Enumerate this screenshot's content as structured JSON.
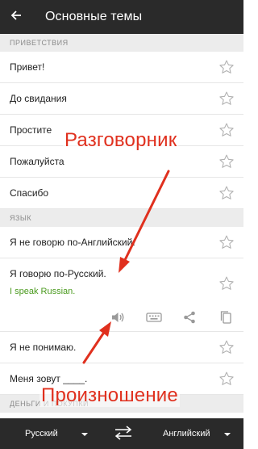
{
  "appbar": {
    "title": "Основные темы"
  },
  "sections": [
    {
      "header": "ПРИВЕТСТВИЯ",
      "items": [
        {
          "label": "Привет!"
        },
        {
          "label": "До свидания"
        },
        {
          "label": "Простите"
        },
        {
          "label": "Пожалуйста"
        },
        {
          "label": "Спасибо"
        }
      ]
    },
    {
      "header": "ЯЗЫК",
      "items": [
        {
          "label": "Я не говорю по-Английский."
        },
        {
          "label": "Я говорю по-Русский.",
          "translation": "I speak Russian.",
          "expanded": true
        },
        {
          "label": "Я не понимаю."
        },
        {
          "label": "Меня зовут ____."
        }
      ]
    },
    {
      "header": "ДЕНЬГИ И ПОКУПКИ",
      "items": []
    }
  ],
  "annotations": {
    "phrasebook": "Разговорник",
    "pronunciation": "Произношение"
  },
  "bottombar": {
    "source_language": "Русский",
    "target_language": "Английский"
  },
  "icons": {
    "back": "arrow-left-icon",
    "favorite": "star-outline-icon",
    "speak": "speaker-icon",
    "keyboard": "keyboard-icon",
    "share": "share-icon",
    "copy": "copy-icon",
    "swap": "swap-arrows-icon"
  },
  "colors": {
    "appbar_bg": "#2a2a2a",
    "section_bg": "#ececec",
    "translation_text": "#4a9a1e",
    "annotation": "#e0301e",
    "star_outline": "#b0b0b0"
  }
}
